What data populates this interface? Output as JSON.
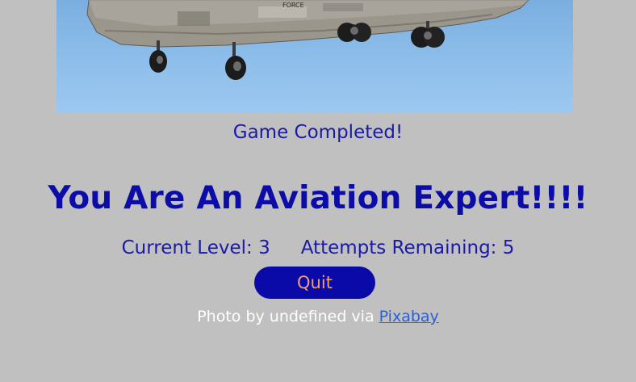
{
  "photo": {
    "subject": "military helicopter underside against blue sky",
    "fuselage_text": "FORCE",
    "colors": {
      "sky": "#8bbce9",
      "fuselage": "#9a968c",
      "wheel": "#1c1c1c"
    }
  },
  "game": {
    "status": "Game Completed!",
    "headline": "You Are An Aviation Expert!!!!",
    "level_text": "Current Level: 3",
    "attempts_text": "Attempts Remaining: 5",
    "quit_label": "Quit"
  },
  "credit": {
    "prefix": "Photo by undefined via",
    "link_label": "Pixabay"
  },
  "colors": {
    "background": "#c0c0c0",
    "text": "#1a1aa6",
    "button": "#0a0aa8",
    "button_text": "#f0a070",
    "link": "#2860d8"
  }
}
